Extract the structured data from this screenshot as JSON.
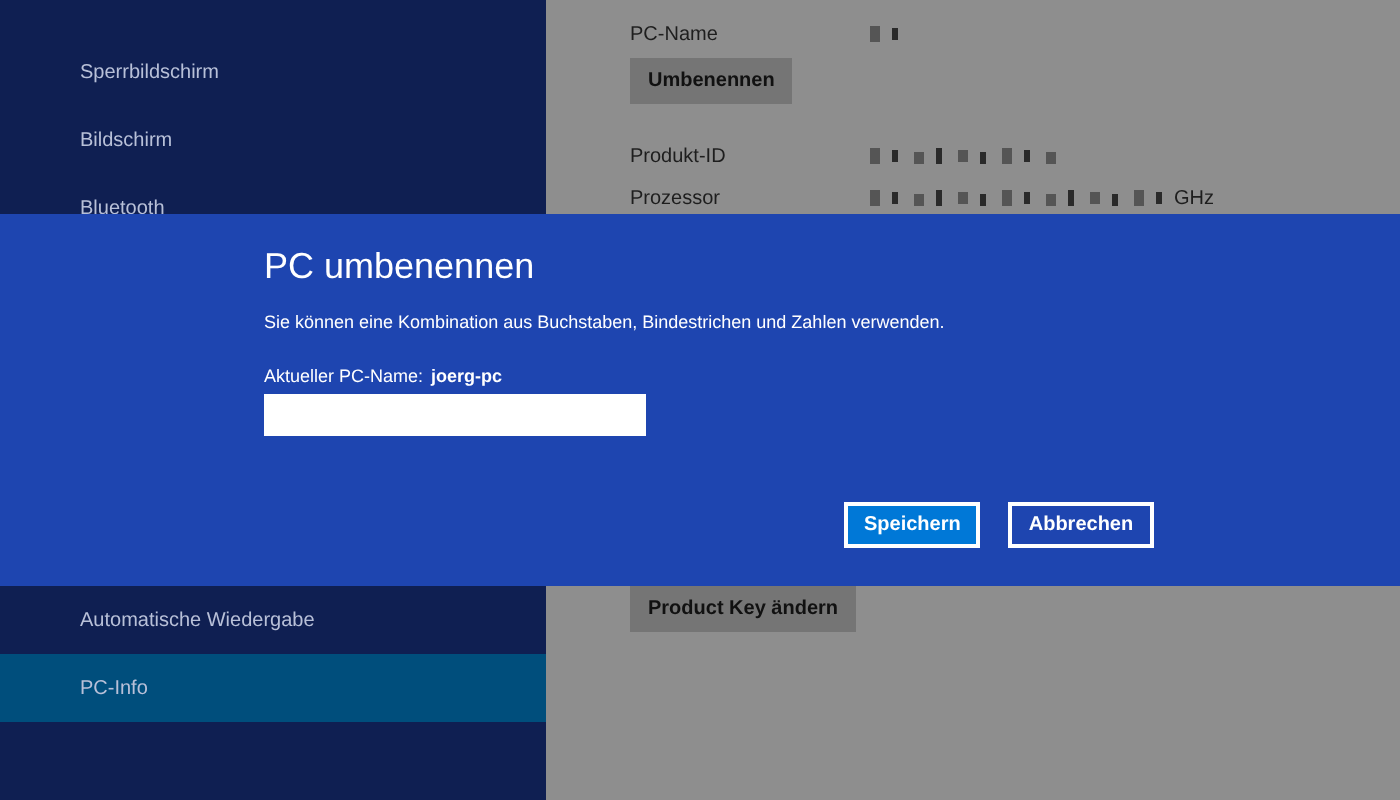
{
  "sidebar": {
    "items": [
      {
        "label": "Sperrbildschirm",
        "selected": false
      },
      {
        "label": "Bildschirm",
        "selected": false
      },
      {
        "label": "Bluetooth",
        "selected": false
      }
    ],
    "bottom_items": [
      {
        "label": "Automatische Wiedergabe",
        "selected": false
      },
      {
        "label": "PC-Info",
        "selected": true
      }
    ]
  },
  "pc_name": {
    "label": "PC-Name",
    "redacted": true,
    "button": "Umbenennen"
  },
  "info_rows": [
    {
      "label": "Produkt-ID",
      "redacted": true
    },
    {
      "label": "Prozessor",
      "redacted": true,
      "unit": "GHz"
    }
  ],
  "product_key_button": "Product Key ändern",
  "dialog": {
    "title": "PC umbenennen",
    "description": "Sie können eine Kombination aus Buchstaben, Bindestrichen und Zahlen verwenden.",
    "current_label": "Aktueller PC-Name:",
    "current_value": "joerg-pc",
    "buttons": [
      {
        "label": "Speichern",
        "kind": "primary"
      },
      {
        "label": "Abbrechen",
        "kind": "secondary"
      }
    ]
  }
}
